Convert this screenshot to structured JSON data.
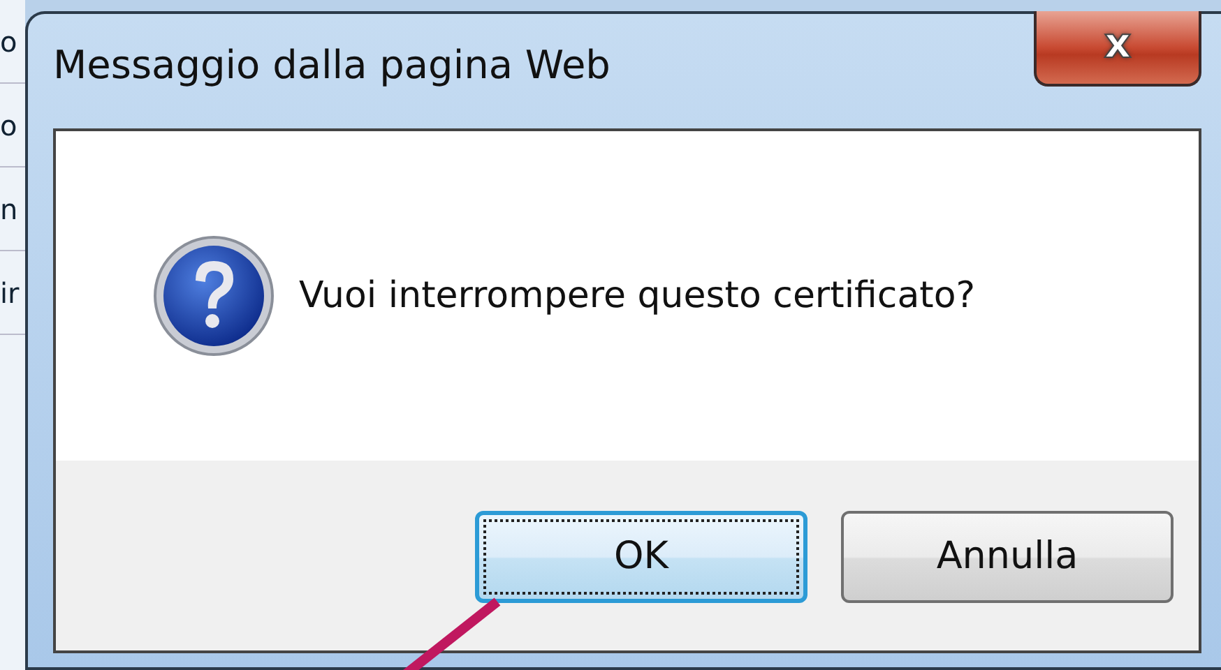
{
  "background_page": {
    "fragments": [
      "o",
      "o",
      "n",
      "ir"
    ]
  },
  "dialog": {
    "title": "Messaggio dalla pagina Web",
    "close_label": "x",
    "message": "Vuoi interrompere questo certificato?",
    "buttons": [
      {
        "label": "OK",
        "focused": true
      },
      {
        "label": "Annulla",
        "focused": false
      }
    ]
  }
}
